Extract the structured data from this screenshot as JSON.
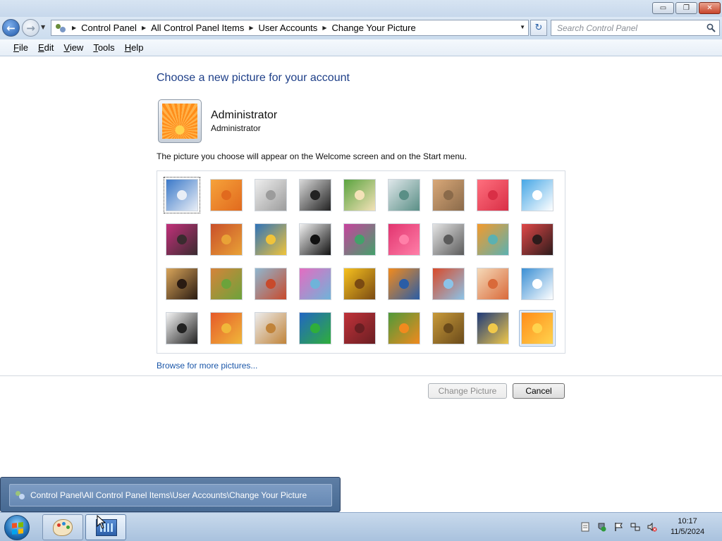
{
  "window": {
    "minimize_glyph": "▭",
    "maximize_glyph": "❐",
    "close_glyph": "✕"
  },
  "address": {
    "back_glyph": "←",
    "forward_glyph": "→",
    "breadcrumbs": [
      "Control Panel",
      "All Control Panel Items",
      "User Accounts",
      "Change Your Picture"
    ],
    "refresh_glyph": "↻"
  },
  "search": {
    "placeholder": "Search Control Panel"
  },
  "menu": [
    "File",
    "Edit",
    "View",
    "Tools",
    "Help"
  ],
  "page": {
    "heading": "Choose a new picture for your account",
    "account_name": "Administrator",
    "account_type": "Administrator",
    "description": "The picture you choose will appear on the Welcome screen and on the Start menu.",
    "browse_link": "Browse for more pictures...",
    "change_button": "Change Picture",
    "cancel_button": "Cancel"
  },
  "pictures": [
    {
      "name": "roller-coaster",
      "colors": [
        "#3b79c9",
        "#e9eef6"
      ]
    },
    {
      "name": "starfish",
      "colors": [
        "#f6a23a",
        "#e16a1e"
      ]
    },
    {
      "name": "robot",
      "colors": [
        "#eeeeee",
        "#9c9c9c"
      ]
    },
    {
      "name": "turntable",
      "colors": [
        "#d9d9d9",
        "#222222"
      ]
    },
    {
      "name": "lucky-cat",
      "colors": [
        "#5aa33f",
        "#f4e2b8"
      ]
    },
    {
      "name": "gyroscope",
      "colors": [
        "#dfe7ea",
        "#5a8f86"
      ]
    },
    {
      "name": "kitten",
      "colors": [
        "#d9a878",
        "#8a6a4a"
      ]
    },
    {
      "name": "flower",
      "colors": [
        "#ff6f7e",
        "#d92f46"
      ]
    },
    {
      "name": "pinwheel",
      "colors": [
        "#46a7e6",
        "#ffffff"
      ]
    },
    {
      "name": "ball",
      "colors": [
        "#c2307a",
        "#3a2b2f"
      ]
    },
    {
      "name": "fabric",
      "colors": [
        "#c94f2a",
        "#e9a236"
      ]
    },
    {
      "name": "leaf",
      "colors": [
        "#2f73b9",
        "#f0c33a"
      ]
    },
    {
      "name": "dog",
      "colors": [
        "#f2f2f2",
        "#111111"
      ]
    },
    {
      "name": "crayons",
      "colors": [
        "#c8429e",
        "#43a16a"
      ]
    },
    {
      "name": "starburst",
      "colors": [
        "#e2346f",
        "#ff7fa8"
      ]
    },
    {
      "name": "jacks",
      "colors": [
        "#e4e4e4",
        "#5b5b5b"
      ]
    },
    {
      "name": "stairs",
      "colors": [
        "#f39a2c",
        "#5bb1b1"
      ]
    },
    {
      "name": "origami",
      "colors": [
        "#e04848",
        "#2d1b1b"
      ]
    },
    {
      "name": "guitar",
      "colors": [
        "#d9a55a",
        "#2a1b12"
      ]
    },
    {
      "name": "puppy",
      "colors": [
        "#d6833a",
        "#6ca33b"
      ]
    },
    {
      "name": "tin-robot",
      "colors": [
        "#8fb7d0",
        "#c84a2c"
      ]
    },
    {
      "name": "scarf",
      "colors": [
        "#e46cc1",
        "#6fb3d9"
      ]
    },
    {
      "name": "sunflower",
      "colors": [
        "#f7c11e",
        "#7a4a12"
      ]
    },
    {
      "name": "fish",
      "colors": [
        "#f38b1d",
        "#2a5da6"
      ]
    },
    {
      "name": "balloon",
      "colors": [
        "#d94a2a",
        "#8bc3e8"
      ]
    },
    {
      "name": "doll",
      "colors": [
        "#f5d9b8",
        "#d96a3a"
      ]
    },
    {
      "name": "sailboat",
      "colors": [
        "#3a8fd4",
        "#ffffff"
      ]
    },
    {
      "name": "soccer-ball",
      "colors": [
        "#f5f5f5",
        "#222222"
      ]
    },
    {
      "name": "weave",
      "colors": [
        "#e65a2a",
        "#f0b73a"
      ]
    },
    {
      "name": "marbles",
      "colors": [
        "#ececec",
        "#c1843a"
      ]
    },
    {
      "name": "window",
      "colors": [
        "#2166c4",
        "#2fae3a"
      ]
    },
    {
      "name": "tapestry",
      "colors": [
        "#c0323a",
        "#6a1e22"
      ]
    },
    {
      "name": "butterfly",
      "colors": [
        "#4f9a3a",
        "#f08a1e"
      ]
    },
    {
      "name": "spiral",
      "colors": [
        "#c89a3a",
        "#6a4a1a"
      ]
    },
    {
      "name": "lighthouse",
      "colors": [
        "#1e3a7a",
        "#f0c84a"
      ]
    },
    {
      "name": "orange-flower",
      "colors": [
        "#ff8d1a",
        "#ffd34d"
      ]
    }
  ],
  "thumbnail": {
    "path": "Control Panel\\All Control Panel Items\\User Accounts\\Change Your Picture"
  },
  "clock": {
    "time": "10:17",
    "date": "11/5/2024"
  }
}
